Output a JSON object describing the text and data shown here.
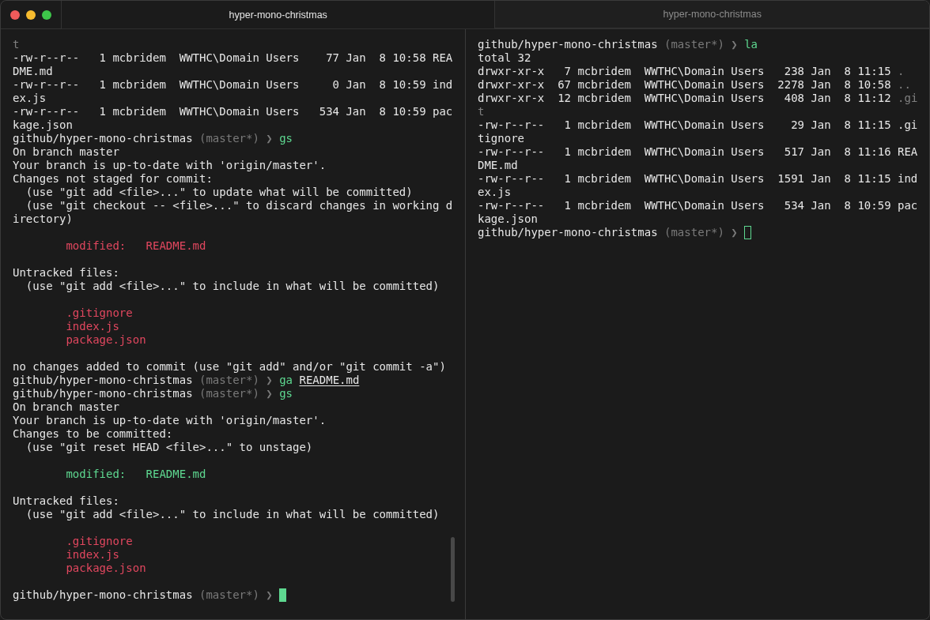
{
  "tabs": [
    {
      "title": "hyper-mono-christmas",
      "selected": true
    },
    {
      "title": "hyper-mono-christmas",
      "selected": false
    }
  ],
  "panes": [
    {
      "focused": true,
      "blocks": [
        {
          "lines": [
            {
              "segments": [
                {
                  "kind": "hidden",
                  "text": "t"
                }
              ]
            },
            {
              "segments": [
                {
                  "kind": "text",
                  "text": "-rw-r--r--   1 mcbridem  WWTHC\\Domain Users    77 Jan  8 10:58 REA"
                }
              ]
            },
            {
              "segments": [
                {
                  "kind": "text",
                  "text": "DME.md"
                }
              ]
            },
            {
              "segments": [
                {
                  "kind": "text",
                  "text": "-rw-r--r--   1 mcbridem  WWTHC\\Domain Users     0 Jan  8 10:59 ind"
                }
              ]
            },
            {
              "segments": [
                {
                  "kind": "text",
                  "text": "ex.js"
                }
              ]
            },
            {
              "segments": [
                {
                  "kind": "text",
                  "text": "-rw-r--r--   1 mcbridem  WWTHC\\Domain Users   534 Jan  8 10:59 pac"
                }
              ]
            },
            {
              "segments": [
                {
                  "kind": "text",
                  "text": "kage.json"
                }
              ]
            },
            {
              "segments": [
                {
                  "kind": "path",
                  "text": "github/hyper-mono-christmas"
                },
                {
                  "kind": "branch",
                  "text": "(master*)"
                },
                {
                  "kind": "chevron",
                  "text": "❯"
                },
                {
                  "kind": "command",
                  "text": "gs"
                }
              ]
            },
            {
              "segments": [
                {
                  "kind": "text",
                  "text": "On branch master"
                }
              ]
            },
            {
              "segments": [
                {
                  "kind": "text",
                  "text": "Your branch is up-to-date with 'origin/master'."
                }
              ]
            },
            {
              "segments": [
                {
                  "kind": "text",
                  "text": "Changes not staged for commit:"
                }
              ]
            },
            {
              "segments": [
                {
                  "kind": "text",
                  "text": "  (use \"git add <file>...\" to update what will be committed)"
                }
              ]
            },
            {
              "segments": [
                {
                  "kind": "text",
                  "text": "  (use \"git checkout -- <file>...\" to discard changes in working d"
                }
              ]
            },
            {
              "segments": [
                {
                  "kind": "text",
                  "text": "irectory)"
                }
              ]
            }
          ]
        },
        {
          "lines": [
            {
              "segments": [
                {
                  "kind": "unstaged",
                  "text": "        modified:   README.md"
                }
              ]
            }
          ]
        },
        {
          "lines": [
            {
              "segments": [
                {
                  "kind": "text",
                  "text": "Untracked files:"
                }
              ]
            },
            {
              "segments": [
                {
                  "kind": "text",
                  "text": "  (use \"git add <file>...\" to include in what will be committed)"
                }
              ]
            }
          ]
        },
        {
          "lines": [
            {
              "segments": [
                {
                  "kind": "untracked",
                  "text": "        .gitignore"
                }
              ]
            },
            {
              "segments": [
                {
                  "kind": "untracked",
                  "text": "        index.js"
                }
              ]
            },
            {
              "segments": [
                {
                  "kind": "untracked",
                  "text": "        package.json"
                }
              ]
            }
          ]
        },
        {
          "lines": [
            {
              "segments": [
                {
                  "kind": "text",
                  "text": "no changes added to commit (use \"git add\" and/or \"git commit -a\")"
                }
              ]
            },
            {
              "segments": [
                {
                  "kind": "path",
                  "text": "github/hyper-mono-christmas"
                },
                {
                  "kind": "branch",
                  "text": "(master*)"
                },
                {
                  "kind": "chevron",
                  "text": "❯"
                },
                {
                  "kind": "command",
                  "text": "ga"
                },
                {
                  "kind": "argument",
                  "text": "README.md"
                }
              ]
            },
            {
              "segments": [
                {
                  "kind": "path",
                  "text": "github/hyper-mono-christmas"
                },
                {
                  "kind": "branch",
                  "text": "(master*)"
                },
                {
                  "kind": "chevron",
                  "text": "❯"
                },
                {
                  "kind": "command",
                  "text": "gs"
                }
              ]
            },
            {
              "segments": [
                {
                  "kind": "text",
                  "text": "On branch master"
                }
              ]
            },
            {
              "segments": [
                {
                  "kind": "text",
                  "text": "Your branch is up-to-date with 'origin/master'."
                }
              ]
            },
            {
              "segments": [
                {
                  "kind": "text",
                  "text": "Changes to be committed:"
                }
              ]
            },
            {
              "segments": [
                {
                  "kind": "text",
                  "text": "  (use \"git reset HEAD <file>...\" to unstage)"
                }
              ]
            }
          ]
        },
        {
          "lines": [
            {
              "segments": [
                {
                  "kind": "staged",
                  "text": "        modified:   README.md"
                }
              ]
            }
          ]
        },
        {
          "lines": [
            {
              "segments": [
                {
                  "kind": "text",
                  "text": "Untracked files:"
                }
              ]
            },
            {
              "segments": [
                {
                  "kind": "text",
                  "text": "  (use \"git add <file>...\" to include in what will be committed)"
                }
              ]
            }
          ]
        },
        {
          "lines": [
            {
              "segments": [
                {
                  "kind": "untracked",
                  "text": "        .gitignore"
                }
              ]
            },
            {
              "segments": [
                {
                  "kind": "untracked",
                  "text": "        index.js"
                }
              ]
            },
            {
              "segments": [
                {
                  "kind": "untracked",
                  "text": "        package.json"
                }
              ]
            }
          ]
        },
        {
          "lines": [
            {
              "segments": [
                {
                  "kind": "path",
                  "text": "github/hyper-mono-christmas"
                },
                {
                  "kind": "branch",
                  "text": "(master*)"
                },
                {
                  "kind": "chevron",
                  "text": "❯"
                }
              ]
            }
          ]
        }
      ]
    },
    {
      "focused": false,
      "blocks": [
        {
          "lines": [
            {
              "segments": [
                {
                  "kind": "path",
                  "text": "github/hyper-mono-christmas"
                },
                {
                  "kind": "branch",
                  "text": "(master*)"
                },
                {
                  "kind": "chevron",
                  "text": "❯"
                },
                {
                  "kind": "command",
                  "text": "la"
                }
              ]
            },
            {
              "segments": [
                {
                  "kind": "text",
                  "text": "total 32"
                }
              ]
            },
            {
              "segments": [
                {
                  "kind": "text",
                  "text": "drwxr-xr-x   7 mcbridem  WWTHC\\Domain Users   238 Jan  8 11:15"
                },
                {
                  "kind": "hidden",
                  "text": "."
                }
              ]
            },
            {
              "segments": [
                {
                  "kind": "text",
                  "text": "drwxr-xr-x  67 mcbridem  WWTHC\\Domain Users  2278 Jan  8 10:58"
                },
                {
                  "kind": "hidden",
                  "text": ".."
                }
              ]
            },
            {
              "segments": [
                {
                  "kind": "text",
                  "text": "drwxr-xr-x  12 mcbridem  WWTHC\\Domain Users   408 Jan  8 11:12"
                },
                {
                  "kind": "hidden",
                  "text": ".gi"
                }
              ]
            },
            {
              "segments": [
                {
                  "kind": "hidden",
                  "text": "t"
                }
              ]
            },
            {
              "segments": [
                {
                  "kind": "text",
                  "text": "-rw-r--r--   1 mcbridem  WWTHC\\Domain Users    29 Jan  8 11:15 .gi"
                }
              ]
            },
            {
              "segments": [
                {
                  "kind": "text",
                  "text": "tignore"
                }
              ]
            },
            {
              "segments": [
                {
                  "kind": "text",
                  "text": "-rw-r--r--   1 mcbridem  WWTHC\\Domain Users   517 Jan  8 11:16 REA"
                }
              ]
            },
            {
              "segments": [
                {
                  "kind": "text",
                  "text": "DME.md"
                }
              ]
            },
            {
              "segments": [
                {
                  "kind": "text",
                  "text": "-rw-r--r--   1 mcbridem  WWTHC\\Domain Users  1591 Jan  8 11:15 ind"
                }
              ]
            },
            {
              "segments": [
                {
                  "kind": "text",
                  "text": "ex.js"
                }
              ]
            },
            {
              "segments": [
                {
                  "kind": "text",
                  "text": "-rw-r--r--   1 mcbridem  WWTHC\\Domain Users   534 Jan  8 10:59 pac"
                }
              ]
            },
            {
              "segments": [
                {
                  "kind": "text",
                  "text": "kage.json"
                }
              ]
            },
            {
              "segments": [
                {
                  "kind": "path",
                  "text": "github/hyper-mono-christmas"
                },
                {
                  "kind": "branch",
                  "text": "(master*)"
                },
                {
                  "kind": "chevron",
                  "text": "❯"
                }
              ]
            }
          ]
        }
      ]
    }
  ]
}
